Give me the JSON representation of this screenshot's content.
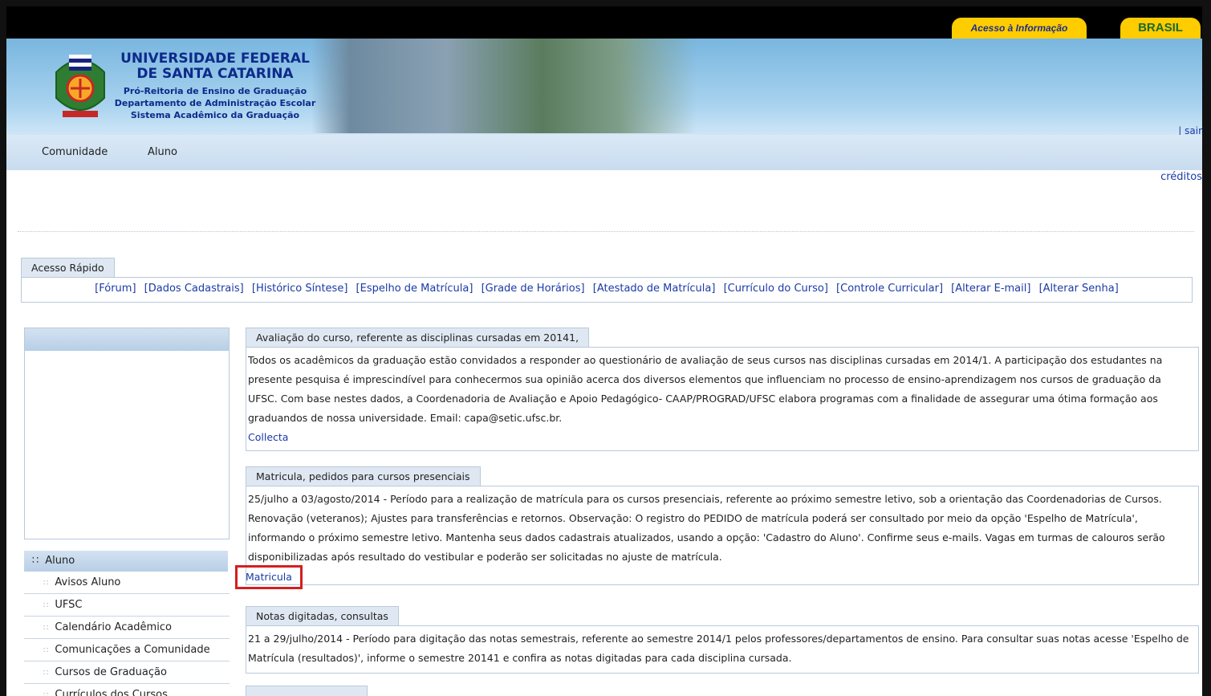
{
  "top": {
    "acesso_informacao": "Acesso à Informação",
    "brasil": "BRASIL"
  },
  "header": {
    "title_line1": "UNIVERSIDADE FEDERAL",
    "title_line2": "DE SANTA CATARINA",
    "sub1": "Pró-Reitoria de Ensino de Graduação",
    "sub2": "Departamento de Administração Escolar",
    "sub3": "Sistema Acadêmico da Graduação",
    "sair": "| sair"
  },
  "nav": {
    "items": [
      "Comunidade",
      "Aluno"
    ],
    "creditos": "créditos"
  },
  "acesso_rapido": {
    "label": "Acesso Rápido",
    "links": [
      "[Fórum]",
      "[Dados Cadastrais]",
      "[Histórico Síntese]",
      "[Espelho de Matrícula]",
      "[Grade de Horários]",
      "[Atestado de Matrícula]",
      "[Currículo do Curso]",
      "[Controle Curricular]",
      "[Alterar E-mail]",
      "[Alterar Senha]"
    ]
  },
  "sidebar": {
    "section": "Aluno",
    "items": [
      "Avisos Aluno",
      "UFSC",
      "Calendário Acadêmico",
      "Comunicações a Comunidade",
      "Cursos de Graduação",
      "Currículos dos Cursos"
    ]
  },
  "news": [
    {
      "title": "Avaliação do curso, referente as disciplinas cursadas em 20141,",
      "body": "Todos os acadêmicos da graduação estão convidados a responder ao questionário de avaliação de seus cursos nas disciplinas cursadas em 2014/1. A participação dos estudantes na presente pesquisa é imprescindível para conhecermos sua opinião acerca dos diversos elementos que influenciam no processo de ensino-aprendizagem nos cursos de graduação da UFSC. Com base nestes dados, a Coordenadoria de Avaliação e Apoio Pedagógico- CAAP/PROGRAD/UFSC elabora programas com a finalidade de assegurar uma ótima formação aos graduandos de nossa universidade. Email: capa@setic.ufsc.br.",
      "link": "Collecta"
    },
    {
      "title": "Matricula, pedidos para cursos presenciais",
      "body": "25/julho a 03/agosto/2014 - Período para a realização de matrícula para os cursos presenciais, referente ao próximo semestre letivo, sob a orientação das Coordenadorias de Cursos. Renovação (veteranos); Ajustes para transferências e retornos. Observação: O registro do PEDIDO de matrícula poderá ser consultado por meio da opção 'Espelho de Matrícula', informando o próximo semestre letivo. Mantenha seus dados cadastrais atualizados, usando a opção: 'Cadastro do Aluno'. Confirme seus e-mails. Vagas em turmas de calouros serão disponibilizadas após resultado do vestibular e poderão ser solicitadas no ajuste de matrícula.",
      "link": "Matricula"
    },
    {
      "title": "Notas digitadas, consultas",
      "body": "21 a 29/julho/2014 - Período para digitação das notas semestrais, referente ao semestre 2014/1 pelos professores/departamentos de ensino. Para consultar suas notas acesse 'Espelho de Matrícula (resultados)', informe o semestre 20141 e confira as notas digitadas para cada disciplina cursada."
    }
  ]
}
